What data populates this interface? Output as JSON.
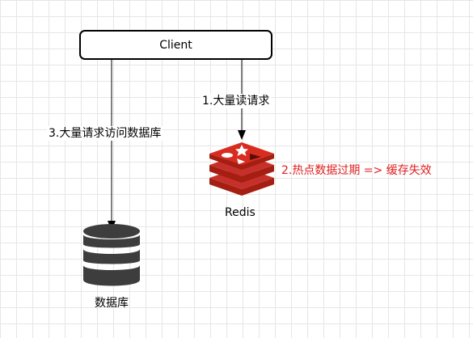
{
  "nodes": {
    "client": {
      "label": "Client"
    },
    "redis": {
      "label": "Redis",
      "icon": "redis-logo-icon"
    },
    "database": {
      "label": "数据库",
      "icon": "database-icon"
    }
  },
  "edges": {
    "client_to_redis": {
      "label": "1.大量读请求"
    },
    "client_to_database": {
      "label": "3.大量请求访问数据库"
    }
  },
  "annotations": {
    "cache_expire": {
      "label": "2.热点数据过期 => 缓存失效",
      "color": "#e02020"
    }
  },
  "colors": {
    "redis_red": "#c6302b",
    "redis_dark": "#a41e11",
    "database_gray": "#3d3d3d",
    "edge": "#000000"
  }
}
